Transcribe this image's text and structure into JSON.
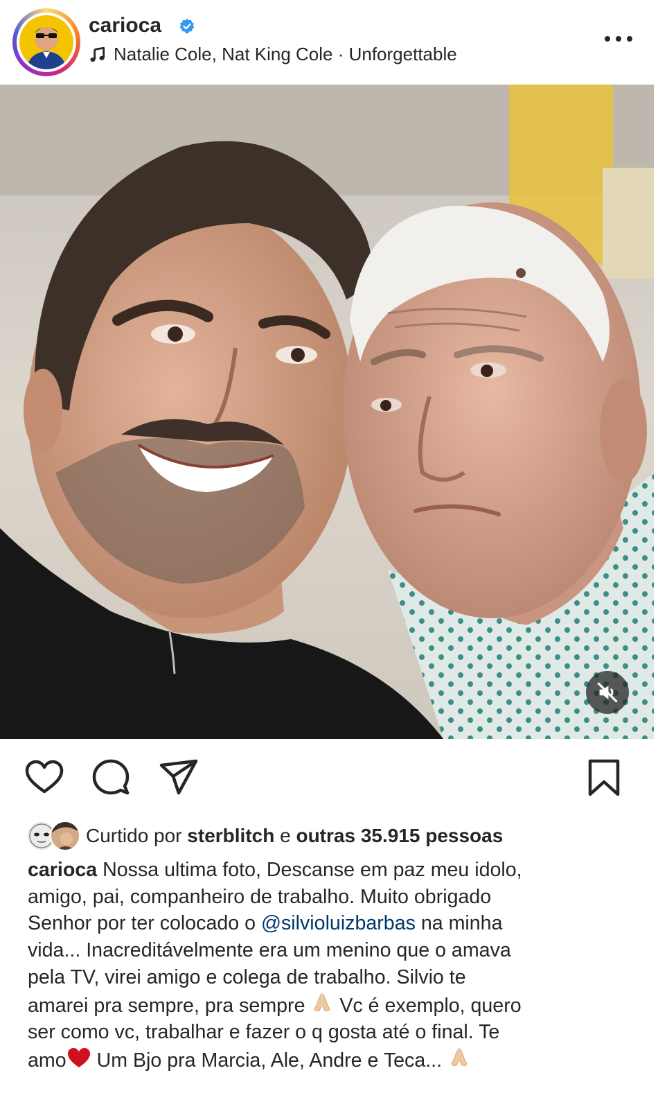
{
  "header": {
    "username": "carioca",
    "music": "Natalie Cole, Nat King Cole · Unforgettable"
  },
  "icons": {
    "verified": "verified-badge-icon",
    "music": "music-note-icon",
    "more": "more-options-icon",
    "mute": "muted-speaker-icon",
    "like": "heart-icon",
    "comment": "comment-icon",
    "share": "send-icon",
    "save": "bookmark-icon"
  },
  "colors": {
    "verified": "#3897f0",
    "mention": "#00376b",
    "text": "#262626",
    "heart_emoji": "#d1101f"
  },
  "likes": {
    "prefix": "Curtido por ",
    "user": "sterblitch",
    "middle": " e ",
    "others": "outras 35.915 pessoas"
  },
  "caption": {
    "username": "carioca",
    "line1": " Nossa ultima foto, Descanse em paz meu idolo,",
    "line2": "amigo, pai, companheiro de trabalho. Muito obrigado",
    "line3a": "Senhor por ter colocado o ",
    "mention": "@silvioluizbarbas",
    "line3b": " na minha",
    "line4": "vida... Inacreditávelmente era um menino que o amava",
    "line5": "pela TV, virei amigo e colega de trabalho. Silvio te",
    "line6a": "amarei pra sempre, pra sempre ",
    "line6b": " Vc é exemplo, quero",
    "line7": "ser como vc, trabalhar e fazer o q gosta até o final. Te",
    "line8a": "amo",
    "line8b": " Um Bjo pra Marcia, Ale, Andre e Teca... "
  }
}
